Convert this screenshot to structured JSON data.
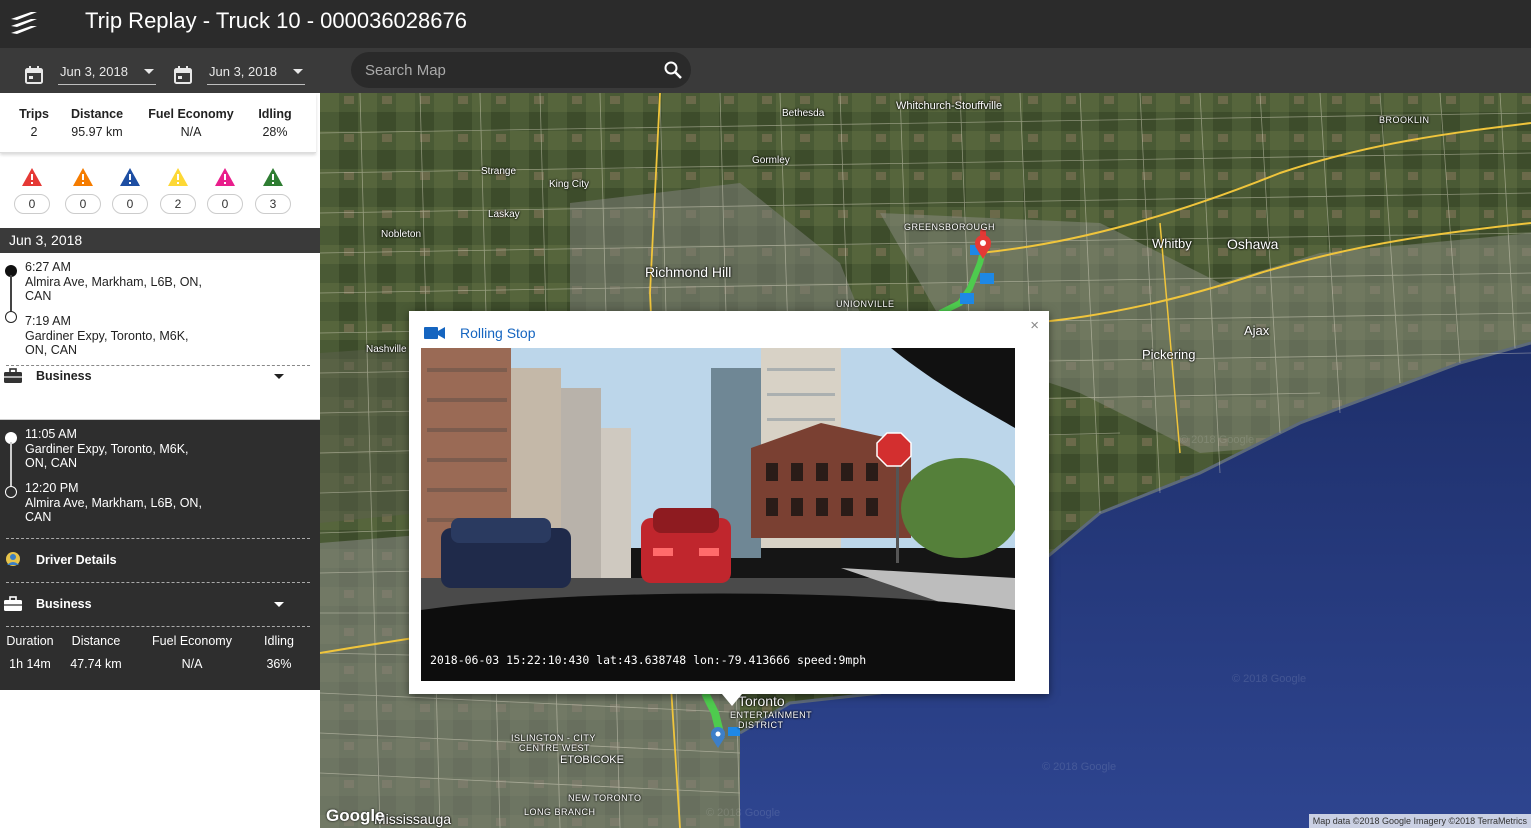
{
  "header": {
    "title": "Trip Replay - Truck 10 - 000036028676",
    "logo_icon": "brand-logo-icon"
  },
  "toolbar": {
    "start_date": "Jun 3, 2018",
    "end_date": "Jun 3, 2018",
    "search_placeholder": "Search Map"
  },
  "summary": {
    "trips_label": "Trips",
    "trips_value": "2",
    "distance_label": "Distance",
    "distance_value": "95.97 km",
    "fuel_label": "Fuel Economy",
    "fuel_value": "N/A",
    "idling_label": "Idling",
    "idling_value": "28%"
  },
  "alerts": [
    {
      "color": "#e53935",
      "count": "0"
    },
    {
      "color": "#f57c00",
      "count": "0"
    },
    {
      "color": "#1e4fa3",
      "count": "0"
    },
    {
      "color": "#fdd835",
      "count": "2"
    },
    {
      "color": "#e91e8c",
      "count": "0"
    },
    {
      "color": "#2e7d32",
      "count": "3"
    }
  ],
  "day": {
    "label": "Jun 3, 2018"
  },
  "trip1": {
    "start_time": "6:27 AM",
    "start_addr_1": "Almira Ave, Markham, L6B, ON,",
    "start_addr_2": "CAN",
    "end_time": "7:19 AM",
    "end_addr_1": "Gardiner Expy, Toronto, M6K,",
    "end_addr_2": "ON, CAN",
    "category": "Business"
  },
  "trip2": {
    "start_time": "11:05 AM",
    "start_addr_1": "Gardiner Expy, Toronto, M6K,",
    "start_addr_2": "ON, CAN",
    "end_time": "12:20 PM",
    "end_addr_1": "Almira Ave, Markham, L6B, ON,",
    "end_addr_2": "CAN",
    "driver_details": "Driver Details",
    "category": "Business",
    "duration_label": "Duration",
    "duration_value": "1h 14m",
    "distance_label": "Distance",
    "distance_value": "47.74 km",
    "fuel_label": "Fuel Economy",
    "fuel_value": "N/A",
    "idling_label": "Idling",
    "idling_value": "36%"
  },
  "map": {
    "places": {
      "whitchurch": "Whitchurch-Stouffville",
      "bethesda": "Bethesda",
      "brooklin": "BROOKLIN",
      "strange": "Strange",
      "kingcity": "King City",
      "gormley": "Gormley",
      "laskay": "Laskay",
      "nobleton": "Nobleton",
      "greensborough": "GREENSBOROUGH",
      "richmondhill": "Richmond Hill",
      "unionville": "UNIONVILLE",
      "whitby": "Whitby",
      "oshawa": "Oshawa",
      "ajax": "Ajax",
      "pickering": "Pickering",
      "nashville": "Nashville",
      "toronto": "Toronto",
      "entertainment": "ENTERTAINMENT",
      "district": "DISTRICT",
      "islington": "ISLINGTON - CITY",
      "centrewest": "CENTRE WEST",
      "etobicoke": "ETOBICOKE",
      "newtoronto": "NEW TORONTO",
      "longbranch": "LONG BRANCH",
      "mississauga": "Mississauga"
    },
    "google_logo": "Google",
    "attribution": "Map data ©2018 Google Imagery ©2018 TerraMetrics",
    "watermark": "© 2018 Google"
  },
  "popup": {
    "title": "Rolling Stop",
    "close": "×",
    "timestamp": "2018-06-03 15:22:10:430 lat:43.638748 lon:-79.413666 speed:9mph"
  }
}
